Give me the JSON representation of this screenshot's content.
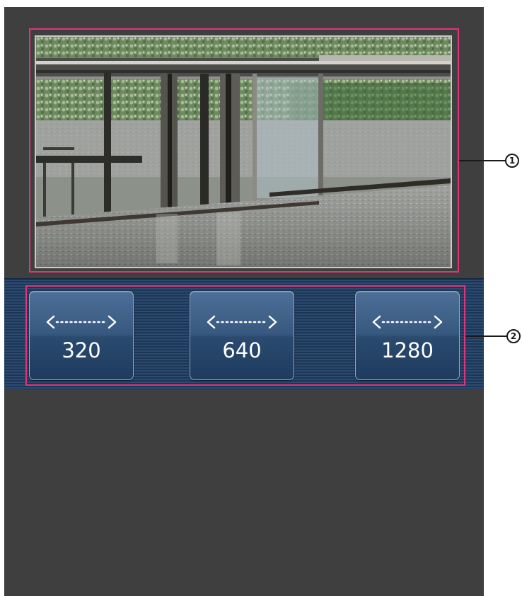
{
  "image_size_buttons": [
    {
      "label": "320",
      "icon": "horizontal-width-arrow-icon"
    },
    {
      "label": "640",
      "icon": "horizontal-width-arrow-icon"
    },
    {
      "label": "1280",
      "icon": "horizontal-width-arrow-icon"
    }
  ],
  "callouts": [
    {
      "number": "①",
      "target": "camera-image"
    },
    {
      "number": "②",
      "target": "image-size-buttons"
    }
  ],
  "colors": {
    "screen_background": "#3f3f3f",
    "highlight_frame": "#e2337d",
    "button_band": "#1d3656",
    "button_face": "#2a4a6f",
    "button_text": "#ffffff"
  }
}
